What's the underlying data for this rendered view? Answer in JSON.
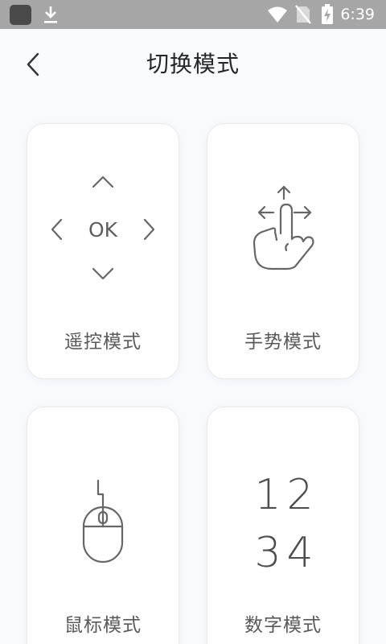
{
  "status_bar": {
    "time": "6:39",
    "icons": [
      "app-icon",
      "download-icon",
      "wifi-icon",
      "no-sim-icon",
      "battery-charging-icon"
    ]
  },
  "header": {
    "title": "切换模式",
    "back_icon": "back-arrow-icon"
  },
  "modes": [
    {
      "label": "遥控模式",
      "icon": "remote-dpad-icon",
      "center_text": "OK"
    },
    {
      "label": "手势模式",
      "icon": "hand-gesture-icon"
    },
    {
      "label": "鼠标模式",
      "icon": "mouse-icon"
    },
    {
      "label": "数字模式",
      "icon": "numbers-icon",
      "digits": [
        "1",
        "2",
        "3",
        "4"
      ]
    }
  ],
  "colors": {
    "status_bar_bg": "#a6a6a6",
    "page_bg": "#f9fafc",
    "card_bg": "#ffffff",
    "icon_stroke": "#666666",
    "label_text": "#595959"
  }
}
